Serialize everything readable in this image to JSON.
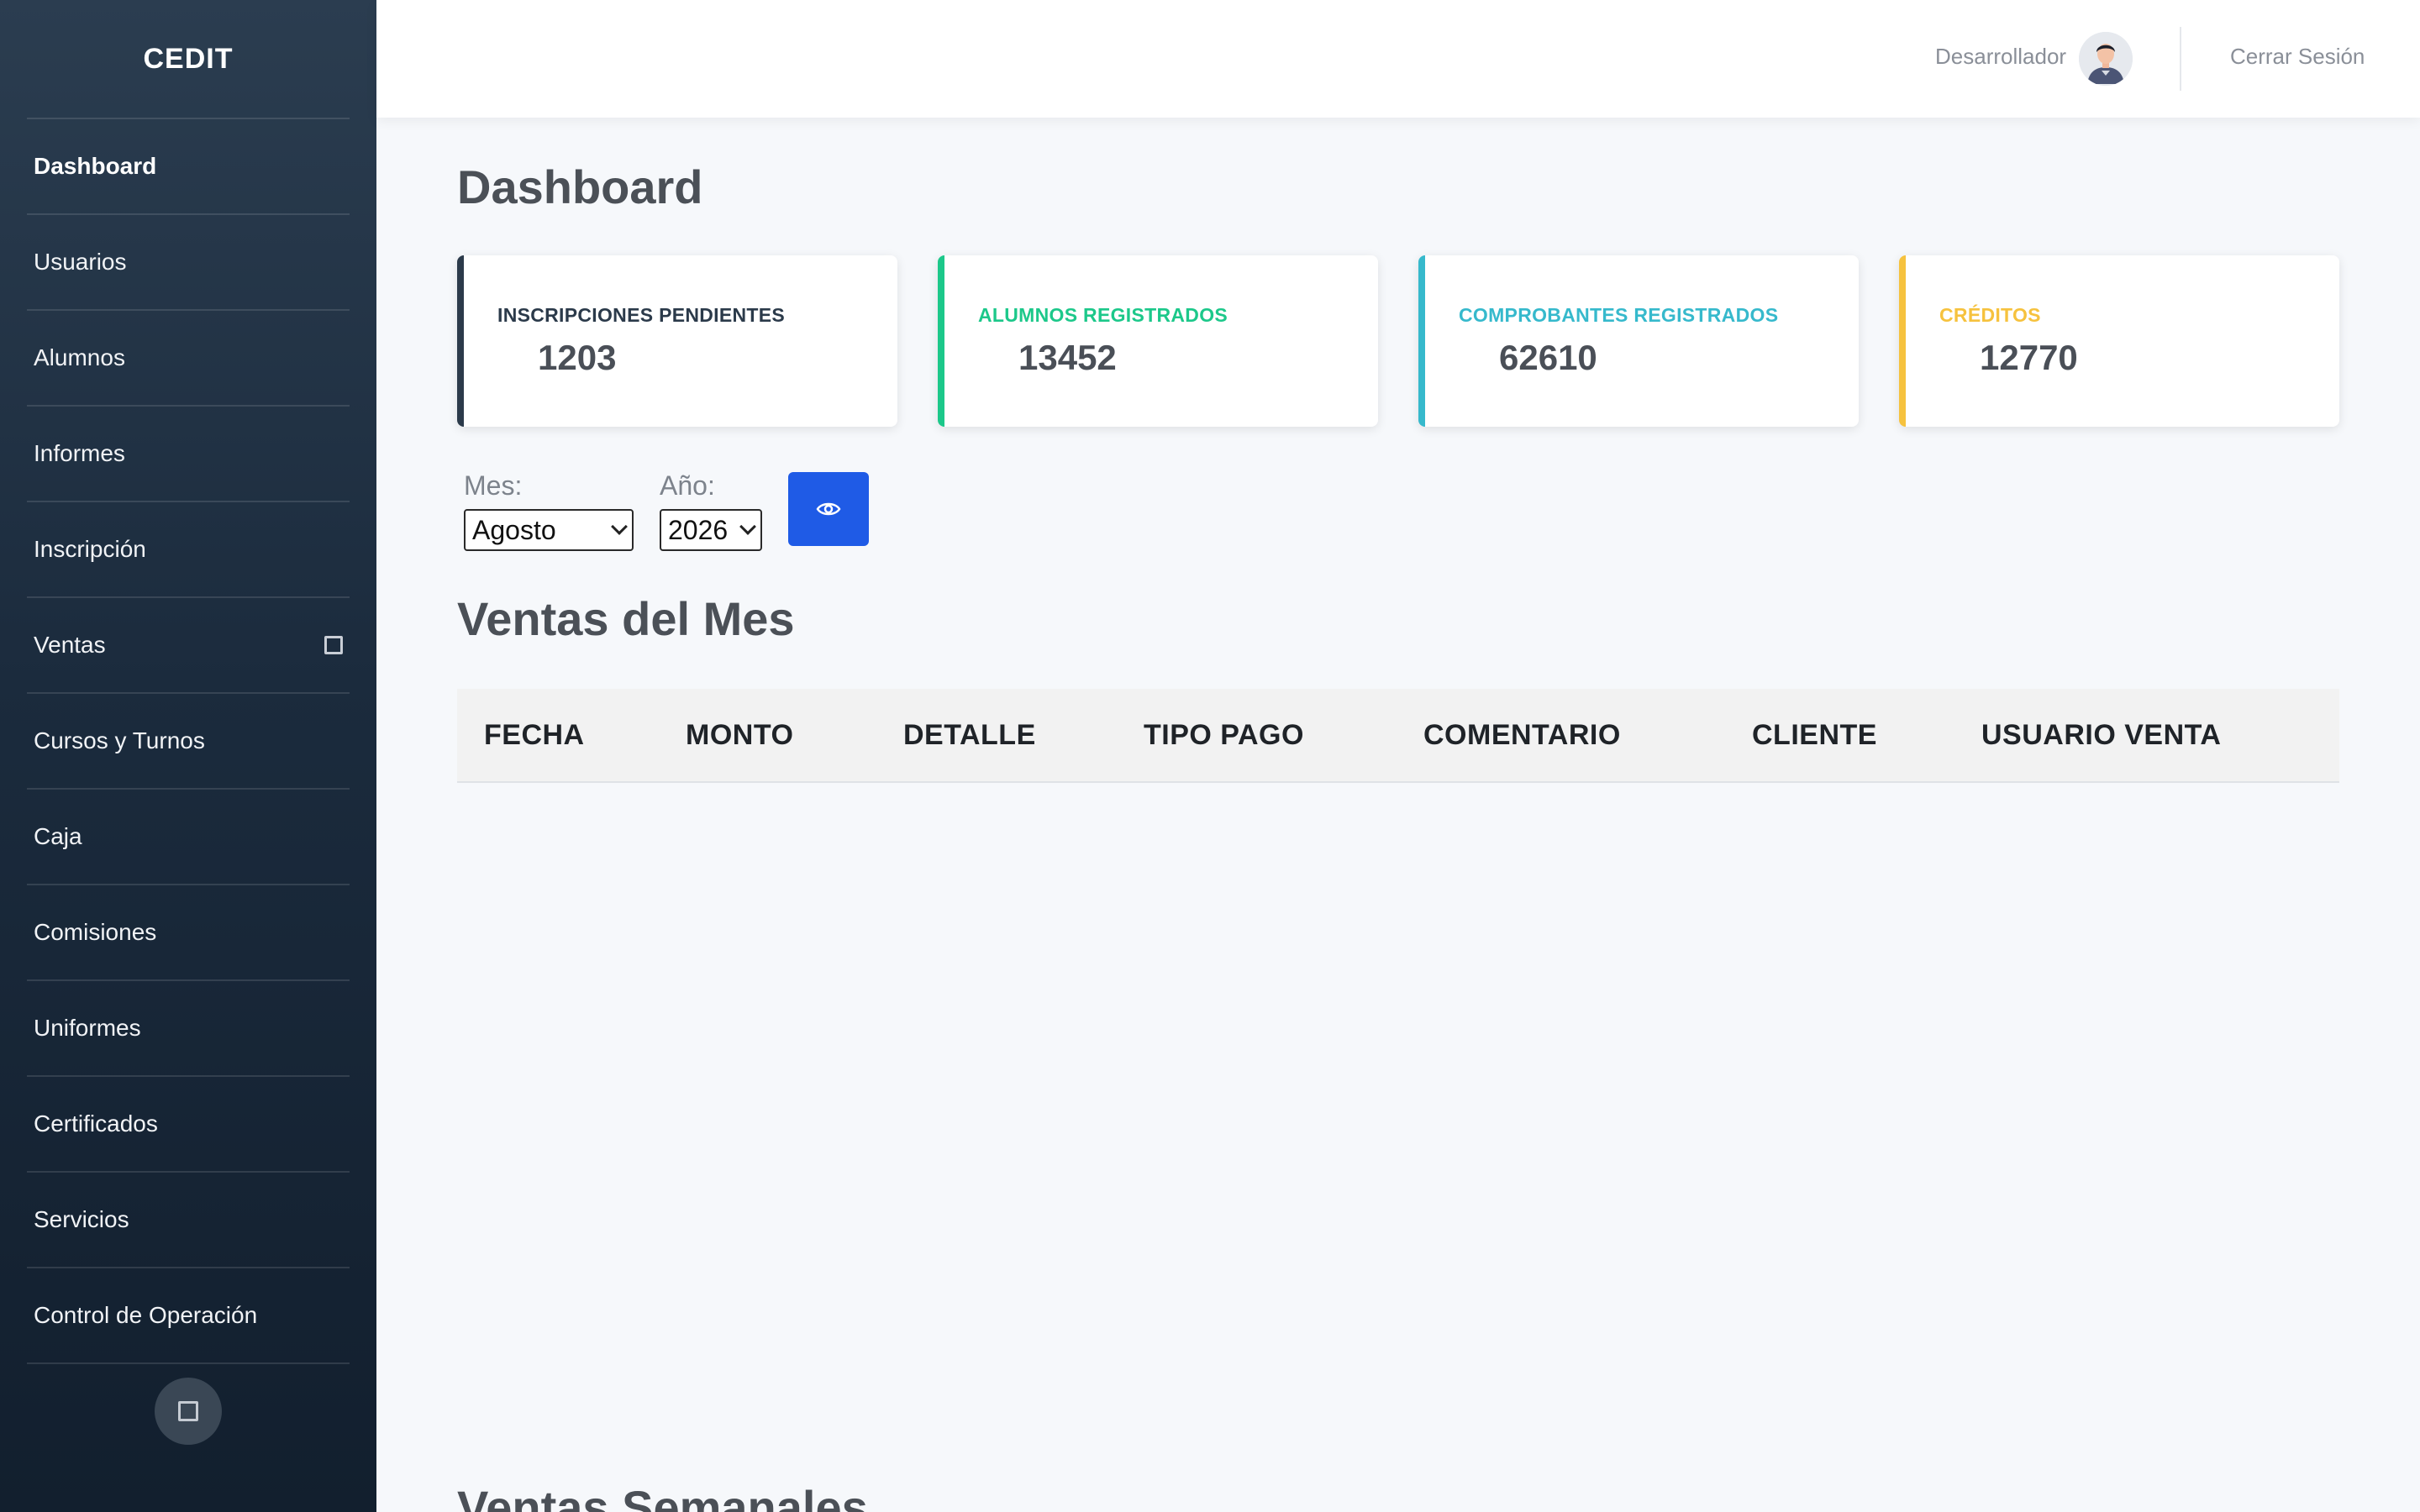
{
  "sidebar": {
    "brand": "CEDIT",
    "items": [
      {
        "label": "Dashboard",
        "active": true
      },
      {
        "label": "Usuarios"
      },
      {
        "label": "Alumnos"
      },
      {
        "label": "Informes"
      },
      {
        "label": "Inscripción"
      },
      {
        "label": "Ventas",
        "icon": "square-icon"
      },
      {
        "label": "Cursos y Turnos"
      },
      {
        "label": "Caja"
      },
      {
        "label": "Comisiones"
      },
      {
        "label": "Uniformes"
      },
      {
        "label": "Certificados"
      },
      {
        "label": "Servicios"
      },
      {
        "label": "Control de Operación"
      }
    ],
    "toggle_icon": "square-icon"
  },
  "topbar": {
    "user_name": "Desarrollador",
    "avatar_icon": "user-avatar-icon",
    "logout_label": "Cerrar Sesión"
  },
  "main": {
    "title": "Dashboard",
    "cards": [
      {
        "label": "INSCRIPCIONES PENDIENTES",
        "value": "1203",
        "color": "#2b3a4a"
      },
      {
        "label": "ALUMNOS REGISTRADOS",
        "value": "13452",
        "color": "#1cc88a"
      },
      {
        "label": "COMPROBANTES REGISTRADOS",
        "value": "62610",
        "color": "#36b9cc"
      },
      {
        "label": "CRÉDITOS",
        "value": "12770",
        "color": "#f6c23e"
      }
    ],
    "filters": {
      "month_label": "Mes:",
      "month_value": "Agosto",
      "year_label": "Año:",
      "year_value": "2026",
      "view_icon": "eye-icon",
      "button_color": "#1f5be6"
    },
    "sales_title": "Ventas del Mes",
    "table_headers": [
      "FECHA",
      "MONTO",
      "DETALLE",
      "TIPO PAGO",
      "COMENTARIO",
      "CLIENTE",
      "USUARIO VENTA"
    ],
    "weekly_title": "Ventas Semanales"
  }
}
